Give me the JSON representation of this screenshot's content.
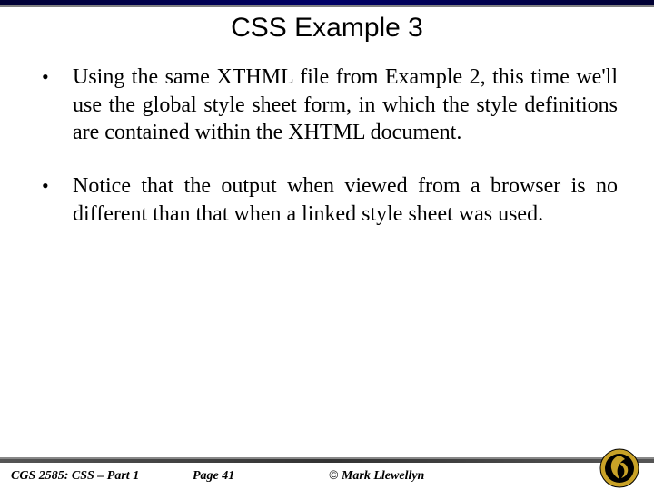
{
  "title": "CSS Example 3",
  "bullets": [
    "Using the same XTHML file from Example 2, this time we'll use the global style sheet form, in which the style definitions are contained within the XHTML document.",
    "Notice that the output when viewed from a browser is no different than that when a linked style sheet was used."
  ],
  "footer": {
    "course": "CGS 2585: CSS – Part 1",
    "page": "Page 41",
    "copyright": "© Mark Llewellyn"
  }
}
